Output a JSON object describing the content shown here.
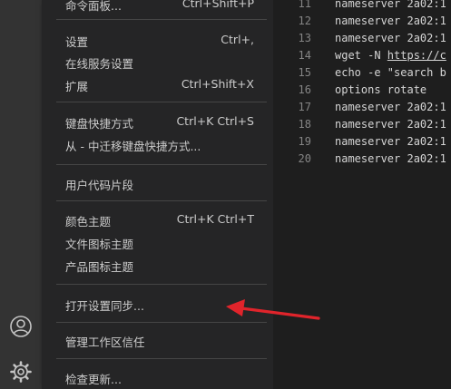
{
  "menu": {
    "items": [
      {
        "label": "命令面板...",
        "shortcut": "Ctrl+Shift+P"
      },
      {
        "label": "设置",
        "shortcut": "Ctrl+,"
      },
      {
        "label": "在线服务设置",
        "shortcut": ""
      },
      {
        "label": "扩展",
        "shortcut": "Ctrl+Shift+X"
      },
      {
        "label": "键盘快捷方式",
        "shortcut": "Ctrl+K Ctrl+S"
      },
      {
        "label": "从 - 中迁移键盘快捷方式...",
        "shortcut": ""
      },
      {
        "label": "用户代码片段",
        "shortcut": ""
      },
      {
        "label": "颜色主题",
        "shortcut": "Ctrl+K Ctrl+T"
      },
      {
        "label": "文件图标主题",
        "shortcut": ""
      },
      {
        "label": "产品图标主题",
        "shortcut": ""
      },
      {
        "label": "打开设置同步...",
        "shortcut": ""
      },
      {
        "label": "管理工作区信任",
        "shortcut": ""
      },
      {
        "label": "检查更新...",
        "shortcut": ""
      }
    ]
  },
  "editor": {
    "lines": [
      {
        "num": "11",
        "text": "nameserver 2a02:1"
      },
      {
        "num": "12",
        "text": "nameserver 2a02:1"
      },
      {
        "num": "13",
        "text": "nameserver 2a02:1"
      },
      {
        "num": "14",
        "pre": "wget -N ",
        "url": "https://c"
      },
      {
        "num": "15",
        "text": "echo -e \"search b"
      },
      {
        "num": "16",
        "text": "options rotate"
      },
      {
        "num": "17",
        "text": "nameserver 2a02:1"
      },
      {
        "num": "18",
        "text": "nameserver 2a02:1"
      },
      {
        "num": "19",
        "text": "nameserver 2a02:1"
      },
      {
        "num": "20",
        "text": "nameserver 2a02:1"
      }
    ]
  },
  "icons": {
    "account": "account-icon",
    "manage": "gear-icon",
    "annotation": "red-arrow"
  },
  "colors": {
    "menu_bg": "#252526",
    "editor_bg": "#1e1e1e",
    "activity_bg": "#333333",
    "arrow": "#e0242b"
  }
}
